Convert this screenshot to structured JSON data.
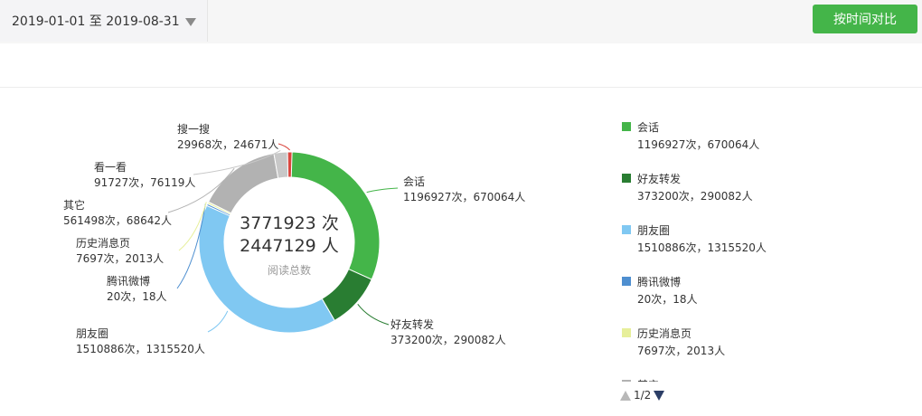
{
  "header": {
    "date_range": "2019-01-01 至 2019-08-31",
    "compare_button": "按时间对比"
  },
  "center": {
    "total_reads": "3771923 次",
    "total_people": "2447129 人",
    "caption": "阅读总数"
  },
  "colors": {
    "accent": "#44b549",
    "track": "#e8e8e8"
  },
  "chart_data": {
    "type": "pie",
    "style": "donut",
    "legend_position": "right",
    "slices": [
      {
        "name": "会话",
        "reads": 1196927,
        "people": 670064,
        "label": "1196927次，670064人",
        "color": "#44b549"
      },
      {
        "name": "好友转发",
        "reads": 373200,
        "people": 290082,
        "label": "373200次，290082人",
        "color": "#297d32"
      },
      {
        "name": "朋友圈",
        "reads": 1510886,
        "people": 1315520,
        "label": "1510886次，1315520人",
        "color": "#80c8f2"
      },
      {
        "name": "腾讯微博",
        "reads": 20,
        "people": 18,
        "label": "20次，18人",
        "color": "#4e8fd0"
      },
      {
        "name": "历史消息页",
        "reads": 7697,
        "people": 2013,
        "label": "7697次，2013人",
        "color": "#e7ef9a"
      },
      {
        "name": "其它",
        "reads": 561498,
        "people": 68642,
        "label": "561498次，68642人",
        "color": "#b2b2b2"
      },
      {
        "name": "看一看",
        "reads": 91727,
        "people": 76119,
        "label": "91727次，76119人",
        "color": "#c8c8c8"
      },
      {
        "name": "搜一搜",
        "reads": 29968,
        "people": 24671,
        "label": "29968次，24671人",
        "color": "#d9473f"
      }
    ]
  },
  "legend": {
    "visible_count": 6,
    "pager_text": "1/2"
  }
}
